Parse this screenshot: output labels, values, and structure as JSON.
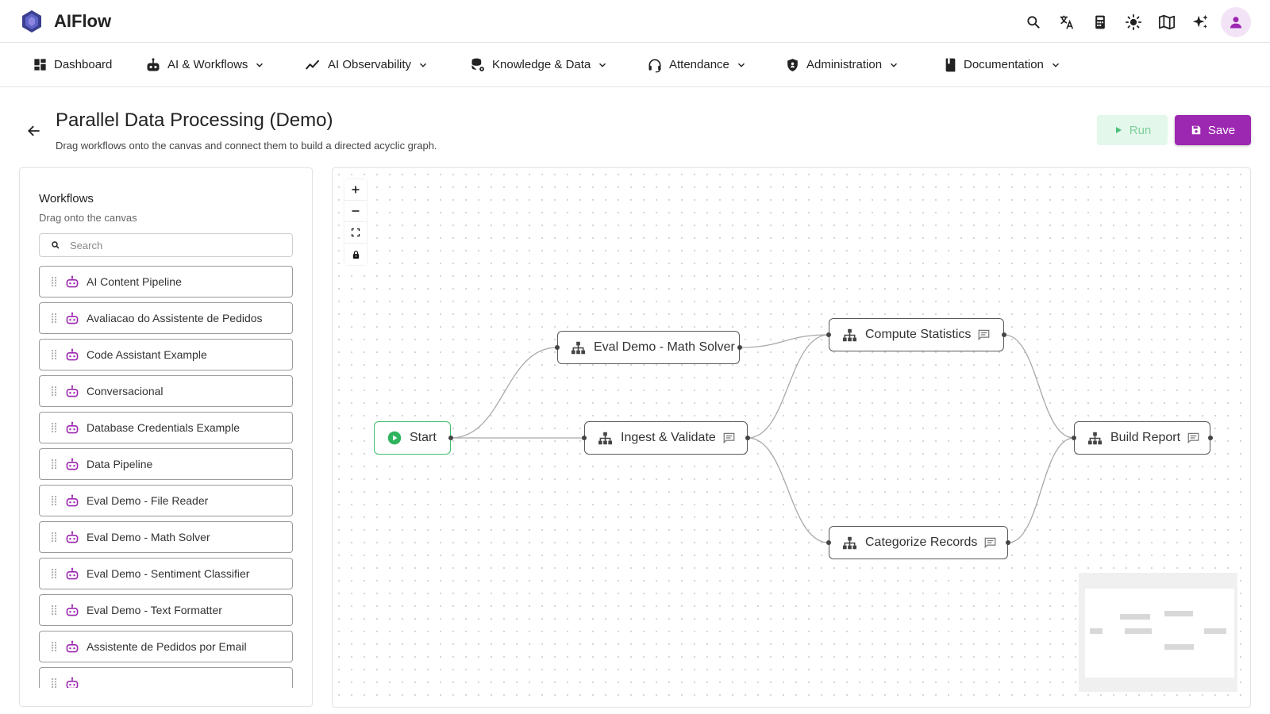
{
  "app": {
    "title": "AIFlow",
    "accent_color": "#9c27b0",
    "top_icons": [
      "search-icon",
      "translate-icon",
      "calculator-icon",
      "theme-sun-icon",
      "book-open-icon",
      "sparkles-icon",
      "user-avatar-icon"
    ]
  },
  "nav": {
    "items": [
      {
        "label": "Dashboard",
        "icon": "dashboard-icon",
        "dropdown": false
      },
      {
        "label": "AI & Workflows",
        "icon": "robot-icon",
        "dropdown": true
      },
      {
        "label": "AI Observability",
        "icon": "trend-line-icon",
        "dropdown": true
      },
      {
        "label": "Knowledge & Data",
        "icon": "database-gear-icon",
        "dropdown": true
      },
      {
        "label": "Attendance",
        "icon": "headset-icon",
        "dropdown": true
      },
      {
        "label": "Administration",
        "icon": "shield-icon",
        "dropdown": true
      },
      {
        "label": "Documentation",
        "icon": "book-icon",
        "dropdown": true
      }
    ]
  },
  "page": {
    "title": "Parallel Data Processing (Demo)",
    "subtitle": "Drag workflows onto the canvas and connect them to build a directed acyclic graph.",
    "run_label": "Run",
    "save_label": "Save"
  },
  "sidebar": {
    "title": "Workflows",
    "subtitle": "Drag onto the canvas",
    "search_placeholder": "Search",
    "items": [
      "AI Content Pipeline",
      "Avaliacao do Assistente de Pedidos",
      "Code Assistant Example",
      "Conversacional",
      "Database Credentials Example",
      "Data Pipeline",
      "Eval Demo - File Reader",
      "Eval Demo - Math Solver",
      "Eval Demo - Sentiment Classifier",
      "Eval Demo - Text Formatter",
      "Assistente de Pedidos por Email",
      ""
    ]
  },
  "canvas": {
    "controls": [
      "zoom-in-icon",
      "zoom-out-icon",
      "fit-view-icon",
      "lock-icon"
    ],
    "nodes": {
      "start": "Start",
      "eval_math": "Eval Demo - Math Solver",
      "ingest": "Ingest & Validate",
      "compute": "Compute Statistics",
      "categorize": "Categorize Records",
      "report": "Build Report"
    },
    "edges": [
      [
        "start",
        "eval_math"
      ],
      [
        "start",
        "ingest"
      ],
      [
        "eval_math",
        "compute"
      ],
      [
        "ingest",
        "compute"
      ],
      [
        "ingest",
        "categorize"
      ],
      [
        "compute",
        "report"
      ],
      [
        "categorize",
        "report"
      ]
    ]
  }
}
